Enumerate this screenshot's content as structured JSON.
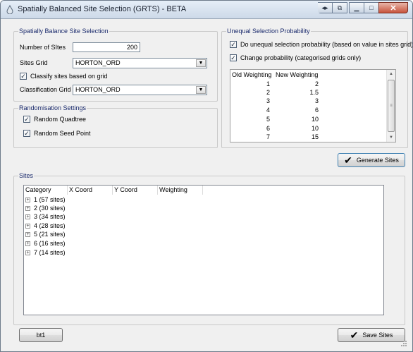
{
  "window": {
    "title": "Spatially Balanced Site Selection (GRTS) - BETA"
  },
  "site_selection": {
    "legend": "Spatially Balance Site Selection",
    "num_sites_label": "Number of SItes",
    "num_sites_value": "200",
    "sites_grid_label": "Sites Grid",
    "sites_grid_value": "HORTON_ORD",
    "classify_label": "Classify sites based on grid",
    "classify_checked": true,
    "class_grid_label": "Classification Grid",
    "class_grid_value": "HORTON_ORD"
  },
  "randomisation": {
    "legend": "Randomisation Settings",
    "quadtree_label": "Random Quadtree",
    "quadtree_checked": true,
    "seed_label": "Random Seed Point",
    "seed_checked": true
  },
  "unequal": {
    "legend": "Unequal Selection Probability",
    "do_unequal_label": "Do unequal selection probability (based on value in sites grid)",
    "do_unequal_checked": true,
    "change_prob_label": "Change probability (categorised grids only)",
    "change_prob_checked": true,
    "grid_headers": [
      "Old Weighting",
      "New Weighting"
    ],
    "grid_rows": [
      [
        "1",
        "2"
      ],
      [
        "2",
        "1.5"
      ],
      [
        "3",
        "3"
      ],
      [
        "4",
        "6"
      ],
      [
        "5",
        "10"
      ],
      [
        "6",
        "10"
      ],
      [
        "7",
        "15"
      ]
    ]
  },
  "generate_button": "Generate Sites",
  "sites": {
    "legend": "Sites",
    "columns": [
      "Category",
      "X Coord",
      "Y Coord",
      "Weighting"
    ],
    "items": [
      "1 (57 sites)",
      "2 (30 sites)",
      "3 (34 sites)",
      "4 (28 sites)",
      "5 (21 sites)",
      "6 (16 sites)",
      "7 (14 sites)"
    ]
  },
  "bt1_button": "bt1",
  "save_button": "Save Sites",
  "icons": {
    "app": "water-drop-icon",
    "check": "checkmark-icon",
    "expand": "plus-expander-icon"
  }
}
